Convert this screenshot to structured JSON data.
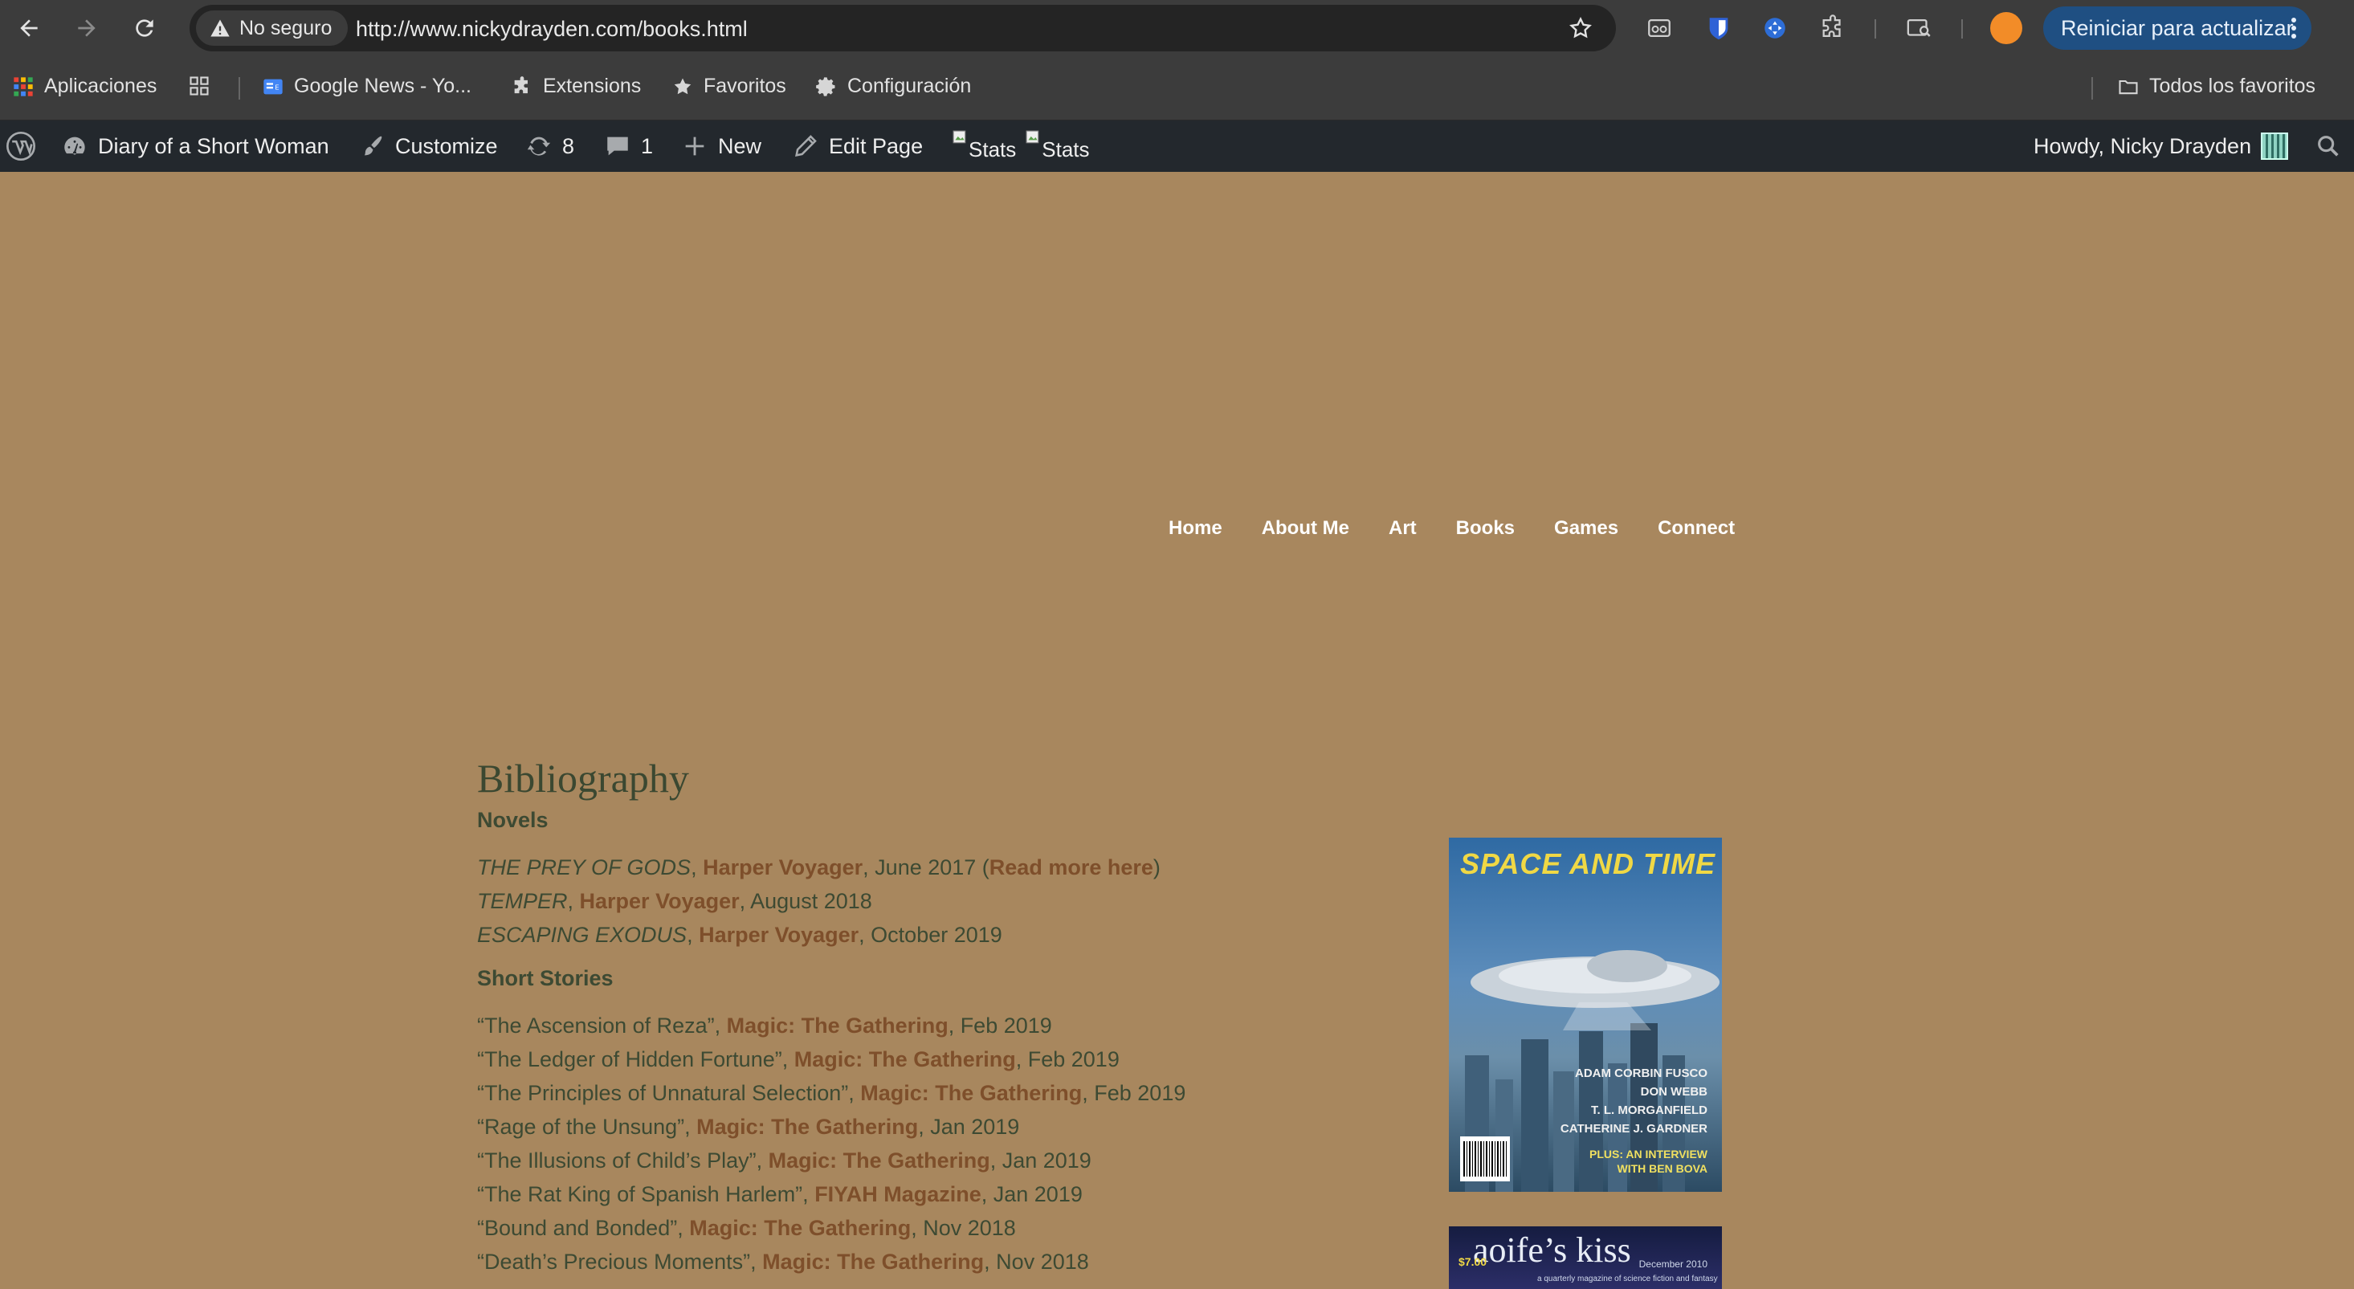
{
  "browser": {
    "security_label": "No seguro",
    "url": "http://www.nickydrayden.com/books.html",
    "update_label": "Reiniciar para actualizar",
    "bookmarks": {
      "apps": "Aplicaciones",
      "google_news": "Google News - Yo...",
      "extensions": "Extensions",
      "favoritos": "Favoritos",
      "configuracion": "Configuración",
      "all_bookmarks": "Todos los favoritos"
    }
  },
  "admin_bar": {
    "site_name": "Diary of a Short Woman",
    "customize": "Customize",
    "updates_count": "8",
    "comments_count": "1",
    "new": "New",
    "edit_page": "Edit Page",
    "stats_alt_1": "Stats",
    "stats_alt_2": "Stats",
    "howdy": "Howdy, Nicky Drayden"
  },
  "nav": [
    "Home",
    "About Me",
    "Art",
    "Books",
    "Games",
    "Connect"
  ],
  "page": {
    "title": "Bibliography",
    "novels_heading": "Novels",
    "novels": [
      {
        "title": "THE PREY OF GODS",
        "publisher": "Harper Voyager",
        "date": ", June 2017 (",
        "extra": "Read more here",
        "close": ")"
      },
      {
        "title": "TEMPER",
        "publisher": "Harper Voyager",
        "date": ", August 2018"
      },
      {
        "title": "ESCAPING EXODUS",
        "publisher": "Harper Voyager",
        "date": ", October 2019"
      }
    ],
    "stories_heading": "Short Stories",
    "stories": [
      {
        "title": "“The Ascension of Reza”, ",
        "publisher": "Magic: The Gathering",
        "date": ", Feb 2019"
      },
      {
        "title": "“The Ledger of Hidden Fortune”, ",
        "publisher": "Magic: The Gathering",
        "date": ", Feb 2019"
      },
      {
        "title": "“The Principles of Unnatural Selection”, ",
        "publisher": "Magic: The Gathering",
        "date": ", Feb 2019"
      },
      {
        "title": "“Rage of the Unsung”, ",
        "publisher": "Magic: The Gathering",
        "date": ", Jan 2019"
      },
      {
        "title": "“The Illusions of Child’s Play”, ",
        "publisher": "Magic: The Gathering",
        "date": ", Jan 2019"
      },
      {
        "title": "“The Rat King of Spanish Harlem”, ",
        "publisher": "FIYAH Magazine",
        "date": ", Jan 2019"
      },
      {
        "title": "“Bound and Bonded”, ",
        "publisher": "Magic: The Gathering",
        "date": ", Nov 2018"
      },
      {
        "title": "“Death’s Precious Moments”, ",
        "publisher": "Magic: The Gathering",
        "date": ", Nov 2018"
      }
    ]
  },
  "covers": {
    "cover1": {
      "masthead": "SPACE AND TIME",
      "names": [
        "ADAM CORBIN FUSCO",
        "DON WEBB",
        "T. L. MORGANFIELD",
        "CATHERINE J. GARDNER"
      ],
      "plus_line1": "PLUS: AN INTERVIEW",
      "plus_line2": "WITH BEN BOVA"
    },
    "cover2": {
      "masthead": "aoife’s kiss",
      "price": "$7.00",
      "date": "December 2010",
      "tagline": "a quarterly magazine of science fiction and fantasy"
    }
  },
  "colors": {
    "page_bg": "#a8875e",
    "link": "#7e4f2b",
    "text": "#3d4a33",
    "admin_bar": "#23282d",
    "update_button": "#1f4f82"
  }
}
